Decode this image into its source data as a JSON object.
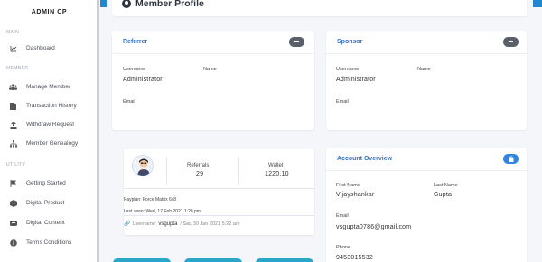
{
  "brand": "ADMIN CP",
  "sidebar": {
    "sections": [
      "MAIN",
      "MEMBER",
      "UTILITY"
    ],
    "items": [
      {
        "label": "Dashboard",
        "icon": "chart-icon"
      },
      {
        "label": "Manage Member",
        "icon": "users-icon"
      },
      {
        "label": "Transaction History",
        "icon": "document-icon"
      },
      {
        "label": "Withdraw Request",
        "icon": "upload-icon"
      },
      {
        "label": "Member Genealogy",
        "icon": "sitemap-icon"
      },
      {
        "label": "Getting Started",
        "icon": "flag-icon"
      },
      {
        "label": "Digital Product",
        "icon": "box-icon"
      },
      {
        "label": "Digital Content",
        "icon": "content-icon"
      },
      {
        "label": "Terms Conditions",
        "icon": "info-icon"
      }
    ]
  },
  "page": {
    "title": "Member Profile"
  },
  "referrer": {
    "title": "Referrer",
    "username_label": "Username",
    "username": "Administrator",
    "name_label": "Name",
    "email_label": "Email"
  },
  "sponsor": {
    "title": "Sponsor",
    "username_label": "Username",
    "username": "Administrator",
    "name_label": "Name",
    "email_label": "Email"
  },
  "member_card": {
    "referrals_label": "Referrals",
    "referrals": "29",
    "wallet_label": "Wallet",
    "wallet": "1220.10",
    "paydes": "Payplan: Force Matrix 6x8",
    "last_seen": "Last seen: Wed, 17 Feb 2021 1:28 pm",
    "username_prefix": "Username:",
    "username": "vsgupta",
    "joined": "/ Sat, 30 Jan 2021 5:22 am"
  },
  "account": {
    "title": "Account Overview",
    "first_name_label": "First Name",
    "first_name": "Vijayshankar",
    "last_name_label": "Last Name",
    "last_name": "Gupta",
    "email_label": "Email",
    "email": "vsgupta0786@gmail.com",
    "phone_label": "Phone",
    "phone": "9453015532"
  },
  "colors": {
    "accent": "#2185d0",
    "link": "#2e73c7",
    "button": "#2aa6c9"
  }
}
